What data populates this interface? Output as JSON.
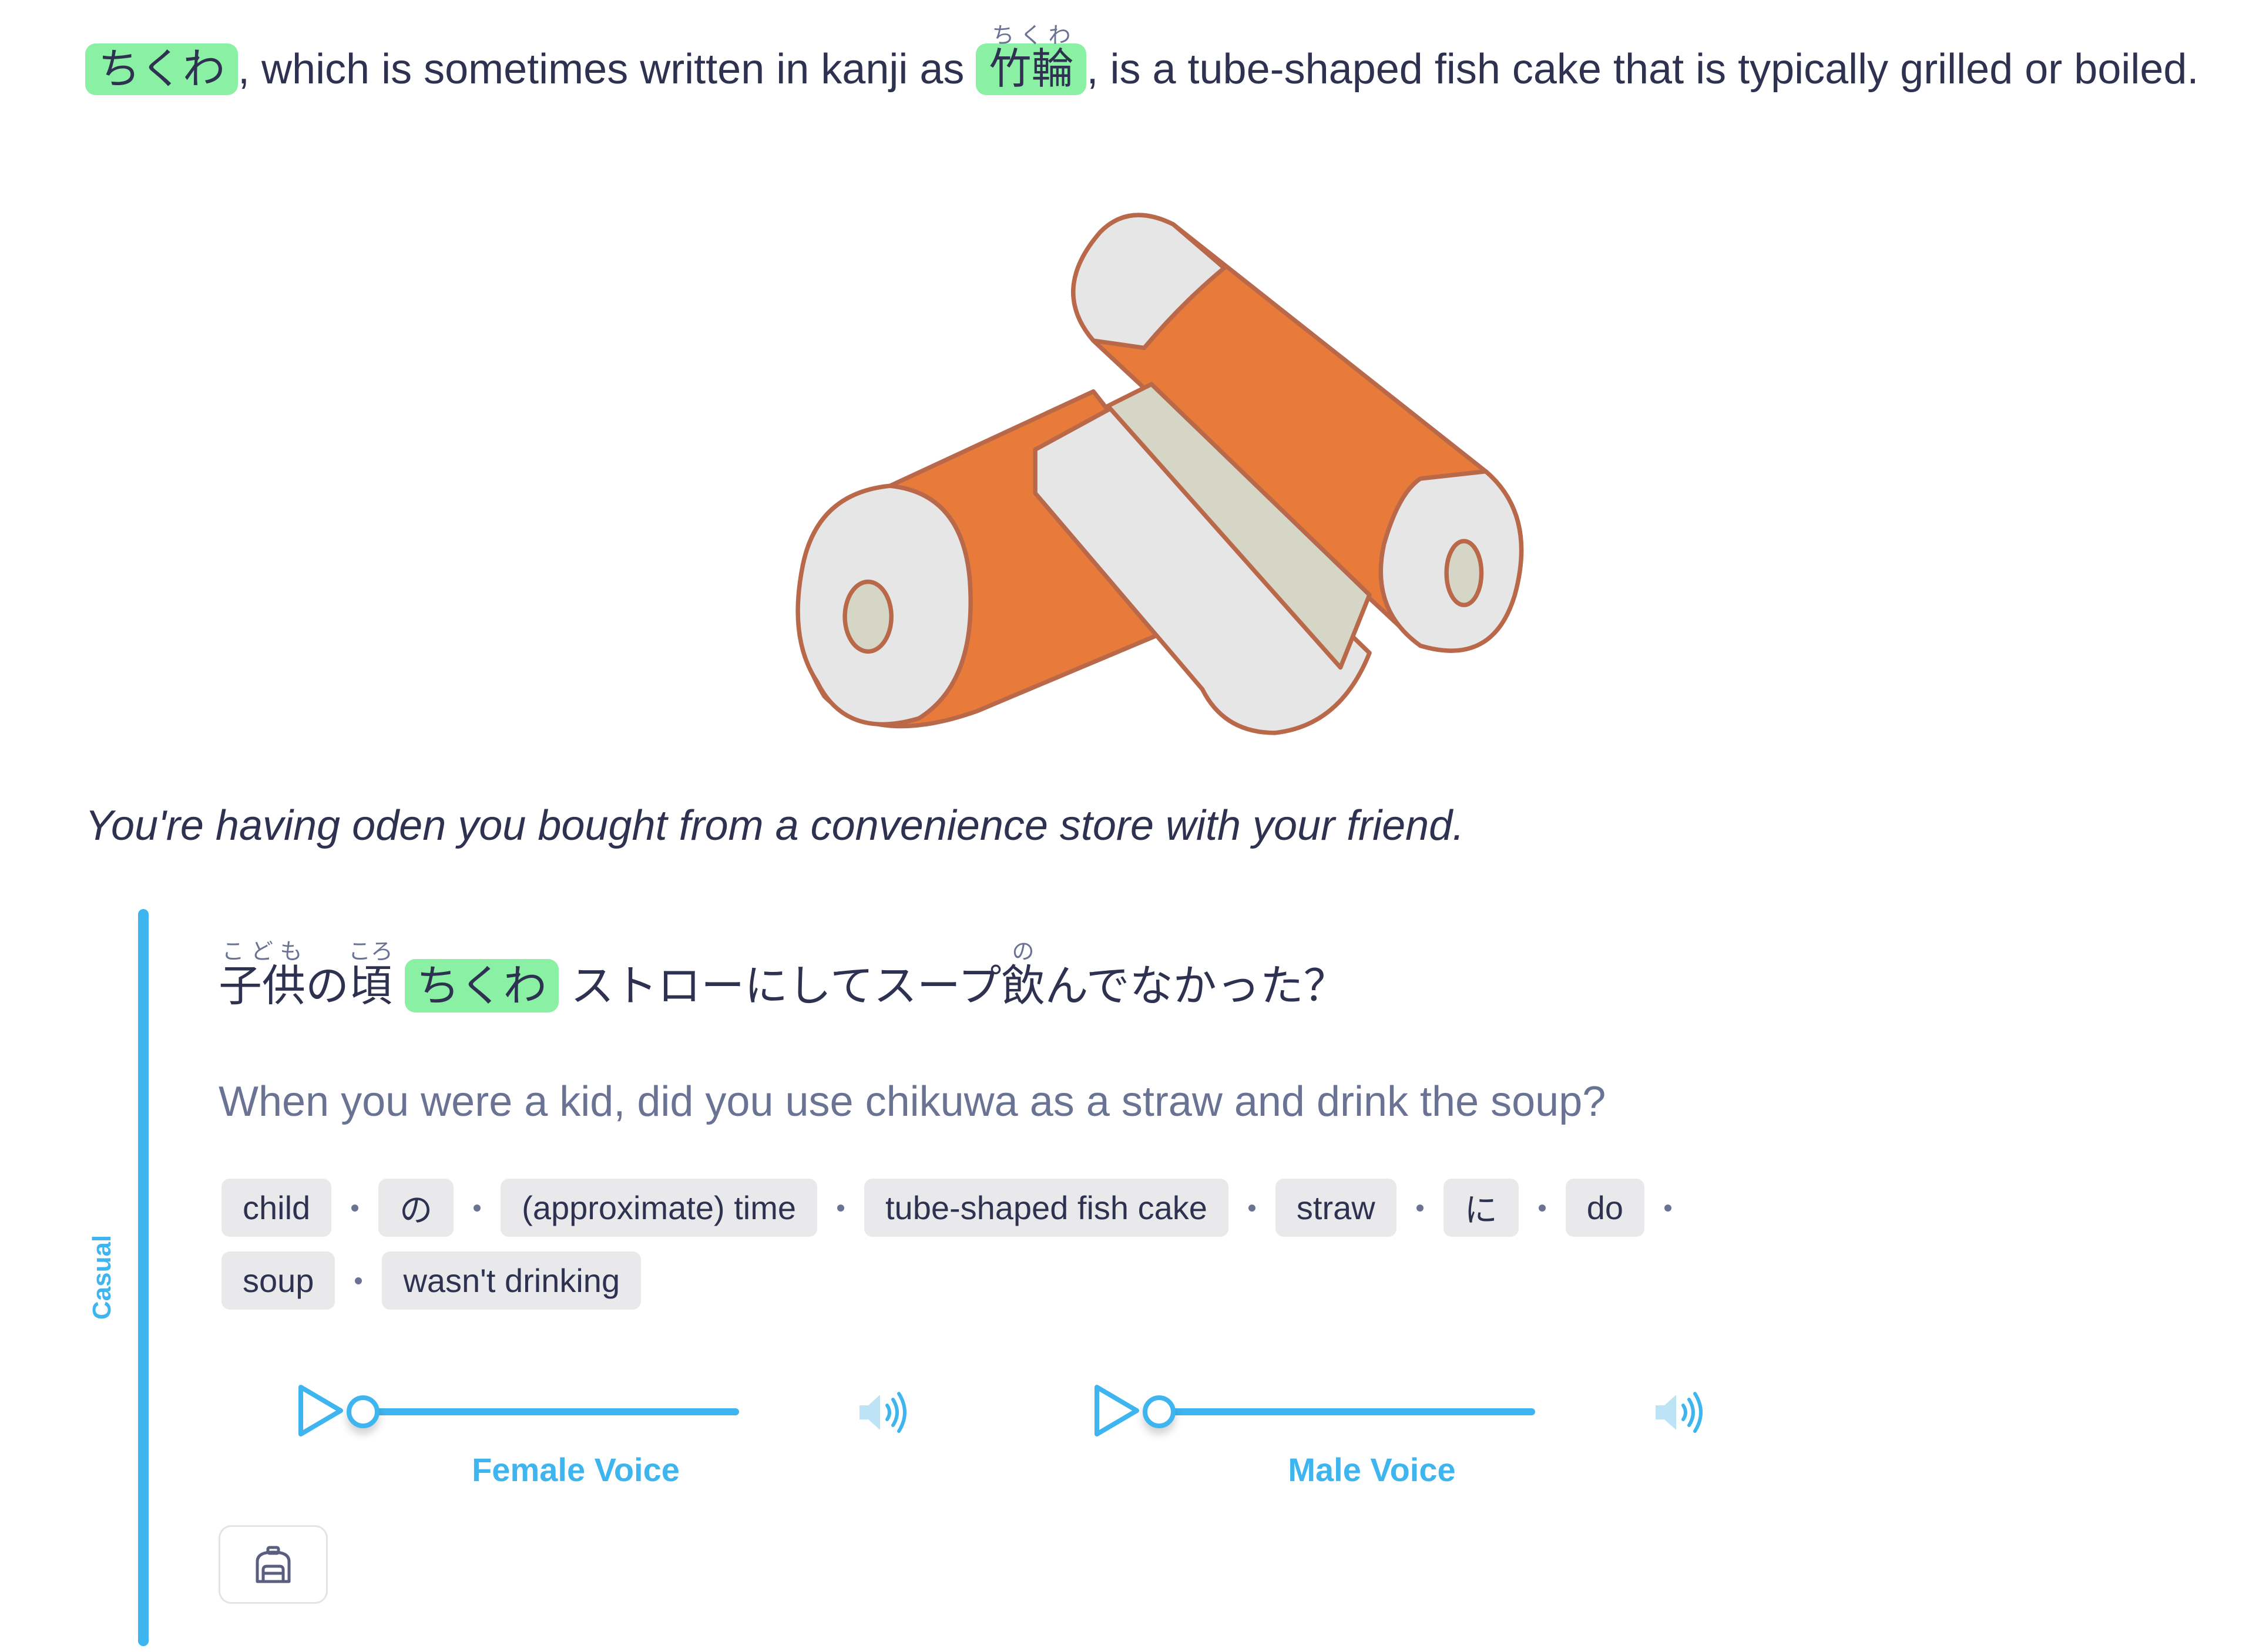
{
  "intro": {
    "term": "ちくわ",
    "text_1": ", which is sometimes written in kanji as ",
    "kanji": "竹輪",
    "kanji_reading": "ちくわ",
    "text_2": ", is a tube-shaped fish cake that is typically grilled or boiled."
  },
  "illustration": {
    "description": "chikuwa illustration"
  },
  "scene": "You're having oden you bought from a convenience store with your friend.",
  "example": {
    "register": "Casual",
    "jp": {
      "kodomo": "子供",
      "kodomo_reading": "こども",
      "no": "の",
      "koro": "頃",
      "koro_reading": "ころ",
      "term": "ちくわ",
      "mid": "ストローにしてスープ",
      "nomu": "飲",
      "nomu_reading": "の",
      "tail": "んでなかった？"
    },
    "en": "When you were a kid, did you use chikuwa as a straw and drink the soup?",
    "chips": [
      "child",
      "の",
      "(approximate) time",
      "tube-shaped fish cake",
      "straw",
      "に",
      "do",
      "soup",
      "wasn't drinking"
    ]
  },
  "audio": [
    {
      "label": "Female Voice",
      "progress": 0
    },
    {
      "label": "Male Voice",
      "progress": 0
    }
  ],
  "colors": {
    "accent": "#3eb5ee",
    "highlight": "#8af0a4",
    "text": "#2e3150",
    "muted": "#6b7394",
    "chip": "#e9e9ec"
  }
}
